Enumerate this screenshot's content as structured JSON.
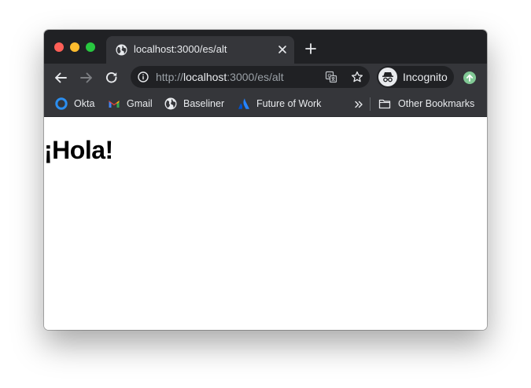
{
  "window": {
    "traffic_lights": {
      "close_color": "#ff5f57",
      "minimize_color": "#febc2e",
      "zoom_color": "#28c840"
    }
  },
  "tab": {
    "title": "localhost:3000/es/alt",
    "favicon": "globe-icon"
  },
  "toolbar": {
    "url_scheme": "http://",
    "url_host": "localhost",
    "url_path": ":3000/es/alt",
    "profile_label": "Incognito",
    "icons": [
      "back-arrow-icon",
      "forward-arrow-icon",
      "reload-icon",
      "site-info-icon",
      "translate-icon",
      "bookmark-star-icon",
      "incognito-icon",
      "update-icon"
    ]
  },
  "bookmarks": {
    "items": [
      {
        "label": "Okta",
        "icon": "okta-icon"
      },
      {
        "label": "Gmail",
        "icon": "gmail-icon"
      },
      {
        "label": "Baseliner",
        "icon": "globe-icon"
      },
      {
        "label": "Future of Work",
        "icon": "atlassian-icon"
      }
    ],
    "other_label": "Other Bookmarks"
  },
  "page": {
    "heading": "¡Hola!"
  }
}
